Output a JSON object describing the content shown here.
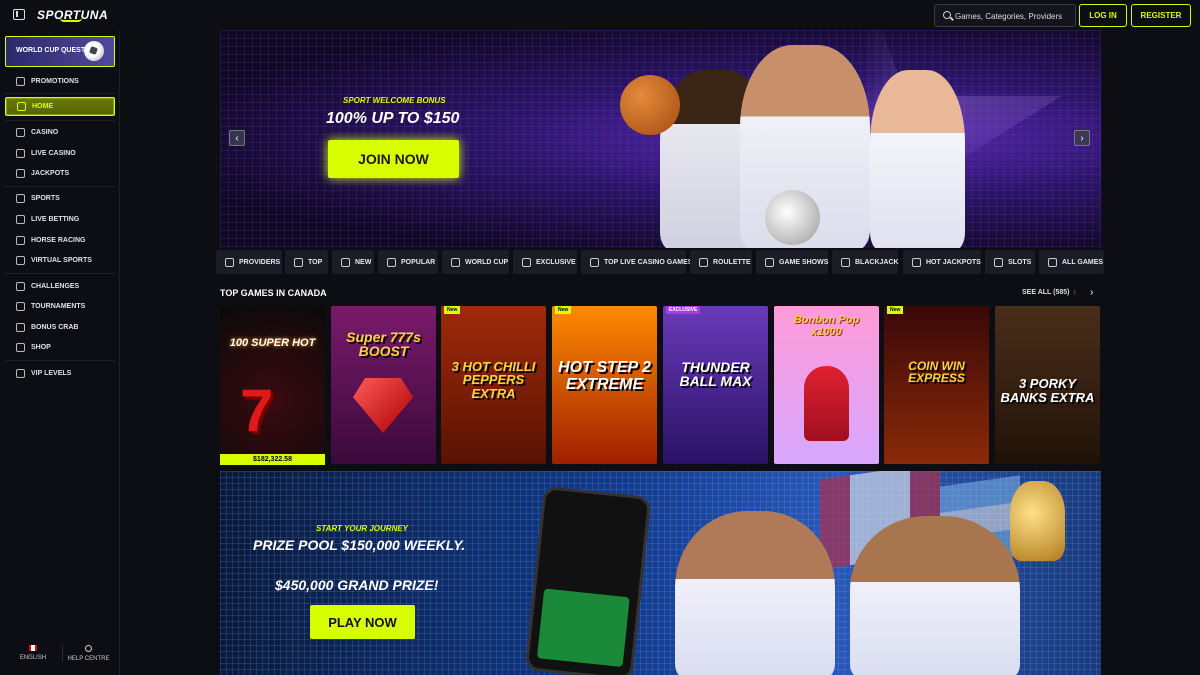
{
  "header": {
    "logo": "SPORTUNA",
    "search_placeholder": "Games, Categories, Providers",
    "login_label": "LOG IN",
    "register_label": "REGISTER"
  },
  "sidebar": {
    "quest_label": "WORLD CUP QUEST",
    "items": [
      {
        "label": "PROMOTIONS",
        "icon": "gift-icon"
      },
      {
        "label": "HOME",
        "icon": "home-icon",
        "active": true
      },
      {
        "label": "CASINO",
        "icon": "casino-icon"
      },
      {
        "label": "LIVE CASINO",
        "icon": "live-casino-icon"
      },
      {
        "label": "JACKPOTS",
        "icon": "jackpot-icon"
      },
      {
        "label": "SPORTS",
        "icon": "sports-icon"
      },
      {
        "label": "LIVE BETTING",
        "icon": "live-betting-icon"
      },
      {
        "label": "HORSE RACING",
        "icon": "horse-icon"
      },
      {
        "label": "VIRTUAL SPORTS",
        "icon": "gamepad-icon"
      },
      {
        "label": "CHALLENGES",
        "icon": "challenges-icon"
      },
      {
        "label": "TOURNAMENTS",
        "icon": "trophy-icon"
      },
      {
        "label": "BONUS CRAB",
        "icon": "crab-icon"
      },
      {
        "label": "SHOP",
        "icon": "shop-icon"
      },
      {
        "label": "VIP LEVELS",
        "icon": "diamond-icon"
      }
    ],
    "footer": {
      "language": "ENGLISH",
      "help": "HELP CENTRE"
    }
  },
  "hero": {
    "subtitle": "SPORT WELCOME BONUS",
    "title": "100% UP TO $150",
    "cta": "JOIN NOW"
  },
  "categories": [
    "PROVIDERS",
    "TOP",
    "NEW",
    "POPULAR",
    "WORLD CUP",
    "EXCLUSIVE",
    "TOP LIVE CASINO GAMES",
    "ROULETTE",
    "GAME SHOWS",
    "BLACKJACK",
    "HOT JACKPOTS",
    "SLOTS",
    "ALL GAMES"
  ],
  "top_games": {
    "title": "TOP GAMES IN CANADA",
    "see_all": "SEE ALL (585)",
    "games": [
      {
        "name": "100 SUPER HOT",
        "jackpot": "$182,322.58",
        "tag": ""
      },
      {
        "name": "Super 777s BOOST",
        "tag": ""
      },
      {
        "name": "3 HOT CHILLI PEPPERS EXTRA",
        "tag": "New"
      },
      {
        "name": "HOT STEP 2 EXTREME",
        "tag": "New"
      },
      {
        "name": "THUNDER BALL MAX",
        "tag": "EXCLUSIVE"
      },
      {
        "name": "Bonbon Pop x1000",
        "tag": ""
      },
      {
        "name": "COIN WIN EXPRESS",
        "tag": "New"
      },
      {
        "name": "3 PORKY BANKS EXTRA",
        "tag": ""
      }
    ]
  },
  "promo": {
    "subtitle": "START YOUR JOURNEY",
    "title": "PRIZE POOL $150,000 WEEKLY.",
    "grand": "$450,000 GRAND PRIZE!",
    "cta": "PLAY NOW"
  },
  "colors": {
    "accent": "#d8ff00",
    "background": "#0d0d14"
  }
}
